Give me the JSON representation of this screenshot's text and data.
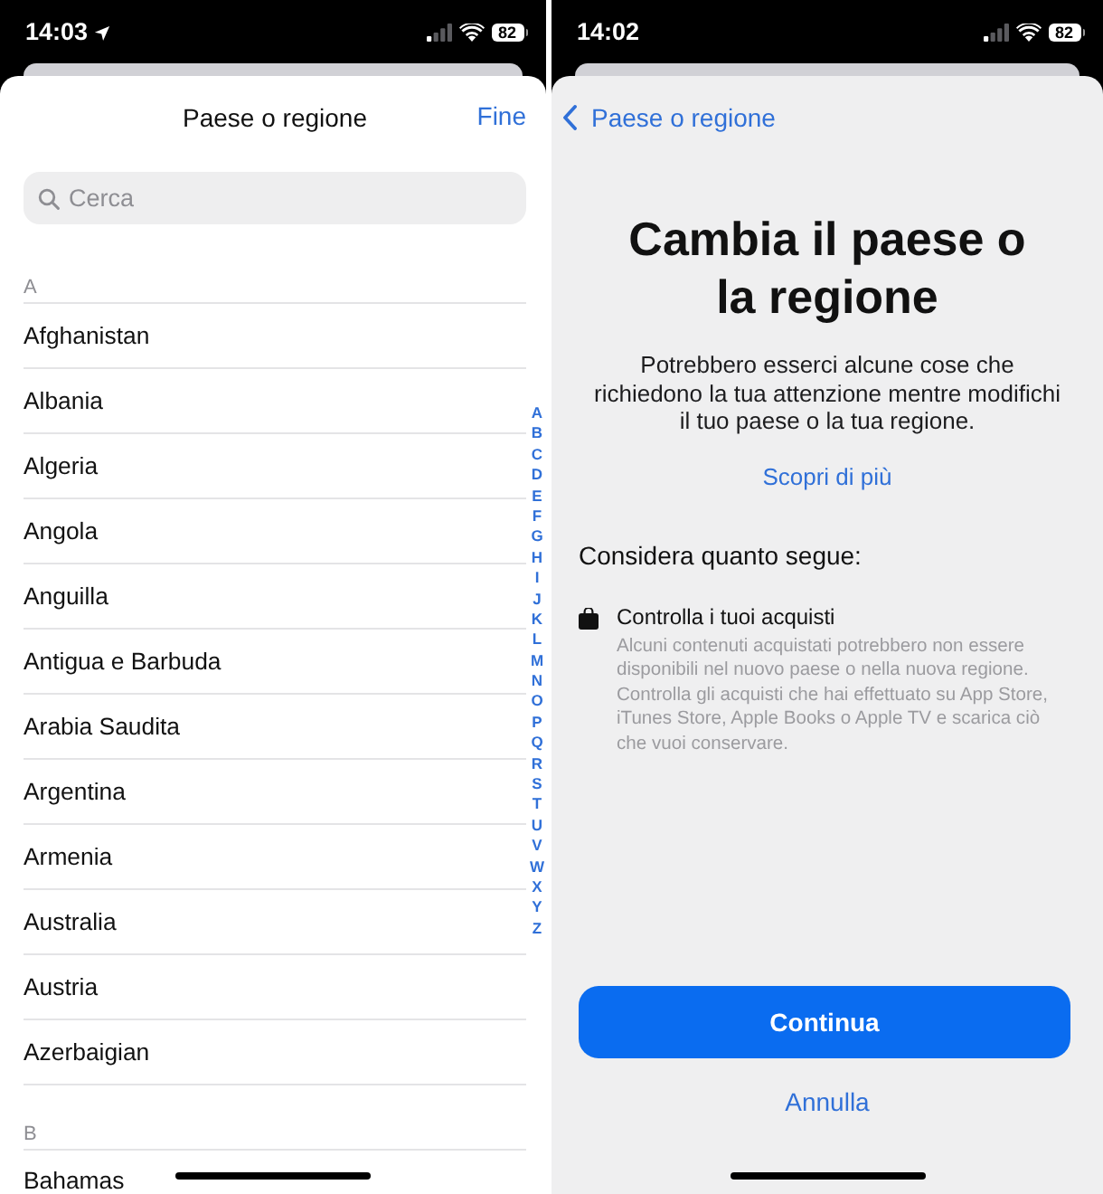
{
  "screens": [
    {
      "kind": "country_picker",
      "status_bar": {
        "time": "14:03",
        "location_active": true,
        "battery": "82"
      },
      "header": {
        "title": "Paese o regione",
        "done": "Fine"
      },
      "search": {
        "placeholder": "Cerca"
      },
      "sections": [
        {
          "letter": "A",
          "items": [
            "Afghanistan",
            "Albania",
            "Algeria",
            "Angola",
            "Anguilla",
            "Antigua e Barbuda",
            "Arabia Saudita",
            "Argentina",
            "Armenia",
            "Australia",
            "Austria",
            "Azerbaigian"
          ]
        },
        {
          "letter": "B",
          "items": [
            "Bahamas"
          ]
        }
      ],
      "index": [
        "A",
        "B",
        "C",
        "D",
        "E",
        "F",
        "G",
        "H",
        "I",
        "J",
        "K",
        "L",
        "M",
        "N",
        "O",
        "P",
        "Q",
        "R",
        "S",
        "T",
        "U",
        "V",
        "W",
        "X",
        "Y",
        "Z"
      ]
    },
    {
      "kind": "region_change",
      "status_bar": {
        "time": "14:02",
        "location_active": false,
        "battery": "82"
      },
      "back": "Paese o regione",
      "title": "Cambia il paese o la regione",
      "intro": "Potrebbero esserci alcune cose che richiedono la tua attenzione mentre modifichi il tuo paese o la tua regione.",
      "link": "Scopri di più",
      "section_title": "Considera quanto segue:",
      "notes": [
        {
          "title": "Controlla i tuoi acquisti",
          "text": "Alcuni contenuti acquistati potrebbero non essere disponibili nel nuovo paese o nella nuova regione. Controlla gli acquisti che hai effettuato su App Store, iTunes Store, Apple Books o Apple TV e scarica ciò che vuoi conservare."
        }
      ],
      "primary_button": "Continua",
      "cancel_button": "Annulla"
    }
  ]
}
